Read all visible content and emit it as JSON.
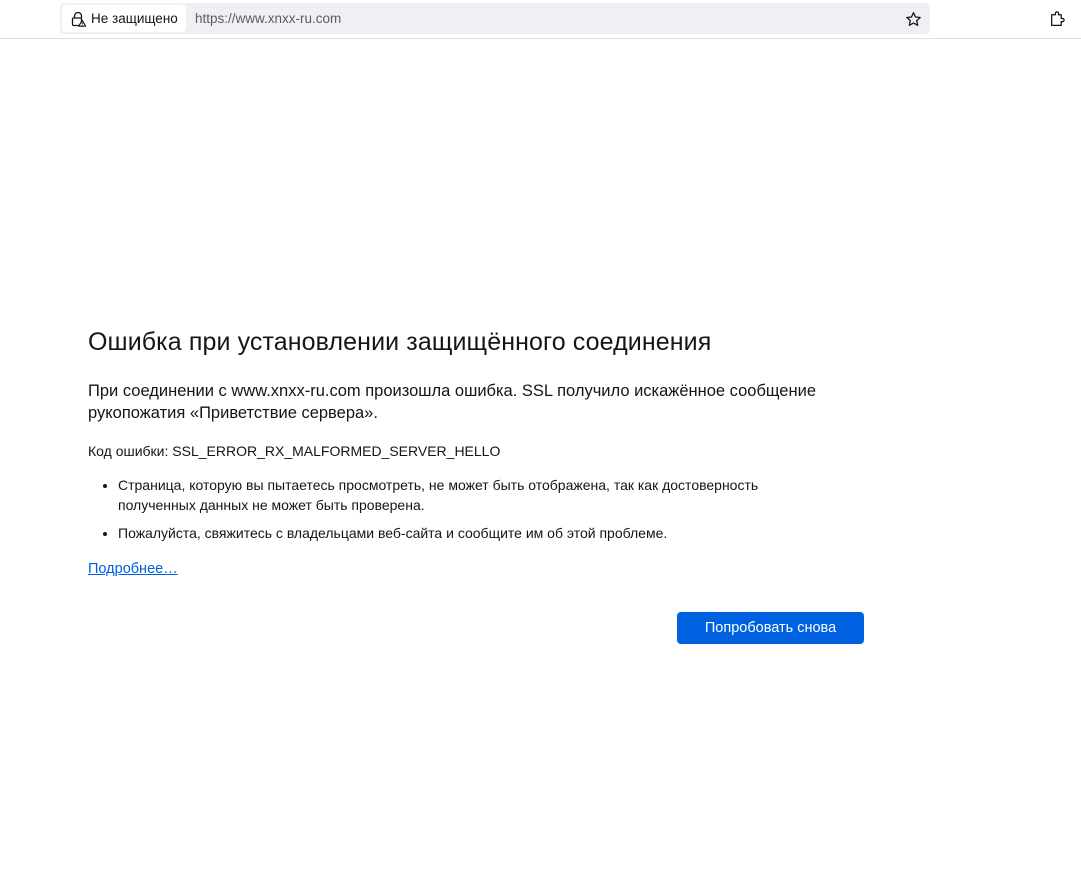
{
  "toolbar": {
    "identity_label": "Не защищено",
    "url": "https://www.xnxx-ru.com",
    "icons": {
      "lock": "lock-warning-icon",
      "bookmark": "star-icon",
      "extensions": "puzzle-icon"
    }
  },
  "error": {
    "title": "Ошибка при установлении защищённого соединения",
    "short_desc": "При соединении с www.xnxx-ru.com произошла ошибка. SSL получило искажённое сообщение рукопожатия «Приветствие сервера».",
    "code": "Код ошибки: SSL_ERROR_RX_MALFORMED_SERVER_HELLO",
    "items": [
      "Страница, которую вы пытаетесь просмотреть, не может быть отображена, так как достоверность полученных данных не может быть проверена.",
      "Пожалуйста, свяжитесь с владельцами веб-сайта и сообщите им об этой проблеме."
    ],
    "learn_more": "Подробнее…",
    "try_again": "Попробовать снова"
  },
  "colors": {
    "accent": "#0061e0",
    "text": "#15141a",
    "url_text": "#5b5b66",
    "urlbar_bg": "#f0f0f4"
  }
}
